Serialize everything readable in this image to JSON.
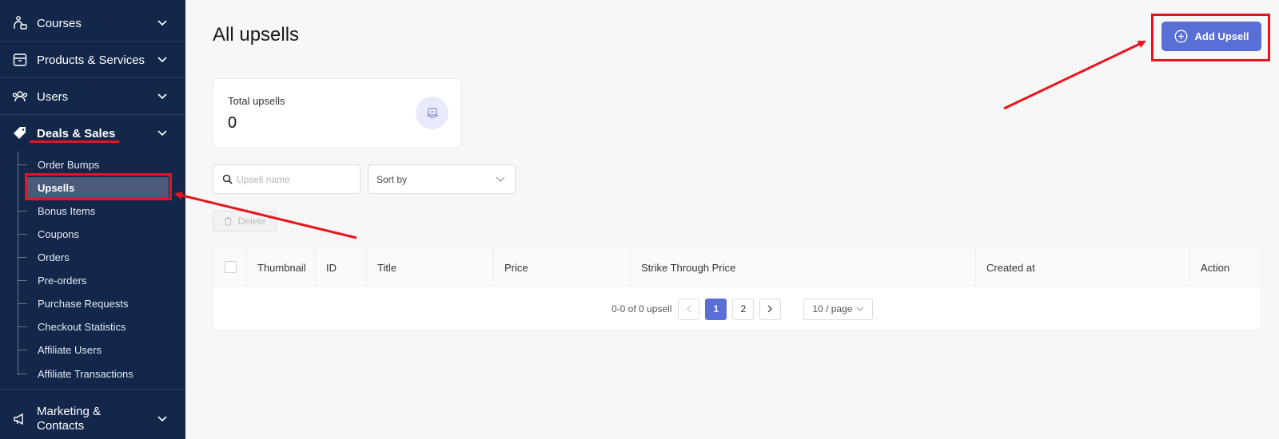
{
  "sidebar": {
    "items": [
      {
        "label": "Courses",
        "icon": "courses-icon"
      },
      {
        "label": "Products & Services",
        "icon": "box-icon"
      },
      {
        "label": "Users",
        "icon": "users-icon"
      },
      {
        "label": "Deals & Sales",
        "icon": "tag-icon"
      },
      {
        "label": "Marketing & Contacts",
        "icon": "megaphone-icon"
      }
    ],
    "deals_sub_items": [
      {
        "label": "Order Bumps"
      },
      {
        "label": "Upsells"
      },
      {
        "label": "Bonus Items"
      },
      {
        "label": "Coupons"
      },
      {
        "label": "Orders"
      },
      {
        "label": "Pre-orders"
      },
      {
        "label": "Purchase Requests"
      },
      {
        "label": "Checkout Statistics"
      },
      {
        "label": "Affiliate Users"
      },
      {
        "label": "Affiliate Transactions"
      }
    ],
    "active_sub_item": "Upsells"
  },
  "header": {
    "title": "All upsells",
    "add_button_label": "Add Upsell"
  },
  "stats": {
    "label": "Total upsells",
    "value": "0"
  },
  "filters": {
    "search_placeholder": "Upsell name",
    "sort_label": "Sort by"
  },
  "toolbar": {
    "delete_label": "Delete"
  },
  "table": {
    "columns": [
      "Thumbnail",
      "ID",
      "Title",
      "Price",
      "Strike Through Price",
      "Created at",
      "Action"
    ]
  },
  "pagination": {
    "info": "0-0 of 0 upsell",
    "prev": "<",
    "next": ">",
    "pages": [
      "1",
      "2"
    ],
    "current_page": "1",
    "page_size": "10 / page"
  },
  "colors": {
    "sidebar_bg": "#13274b",
    "accent": "#5a6fd6",
    "annotation": "#e8141b"
  }
}
